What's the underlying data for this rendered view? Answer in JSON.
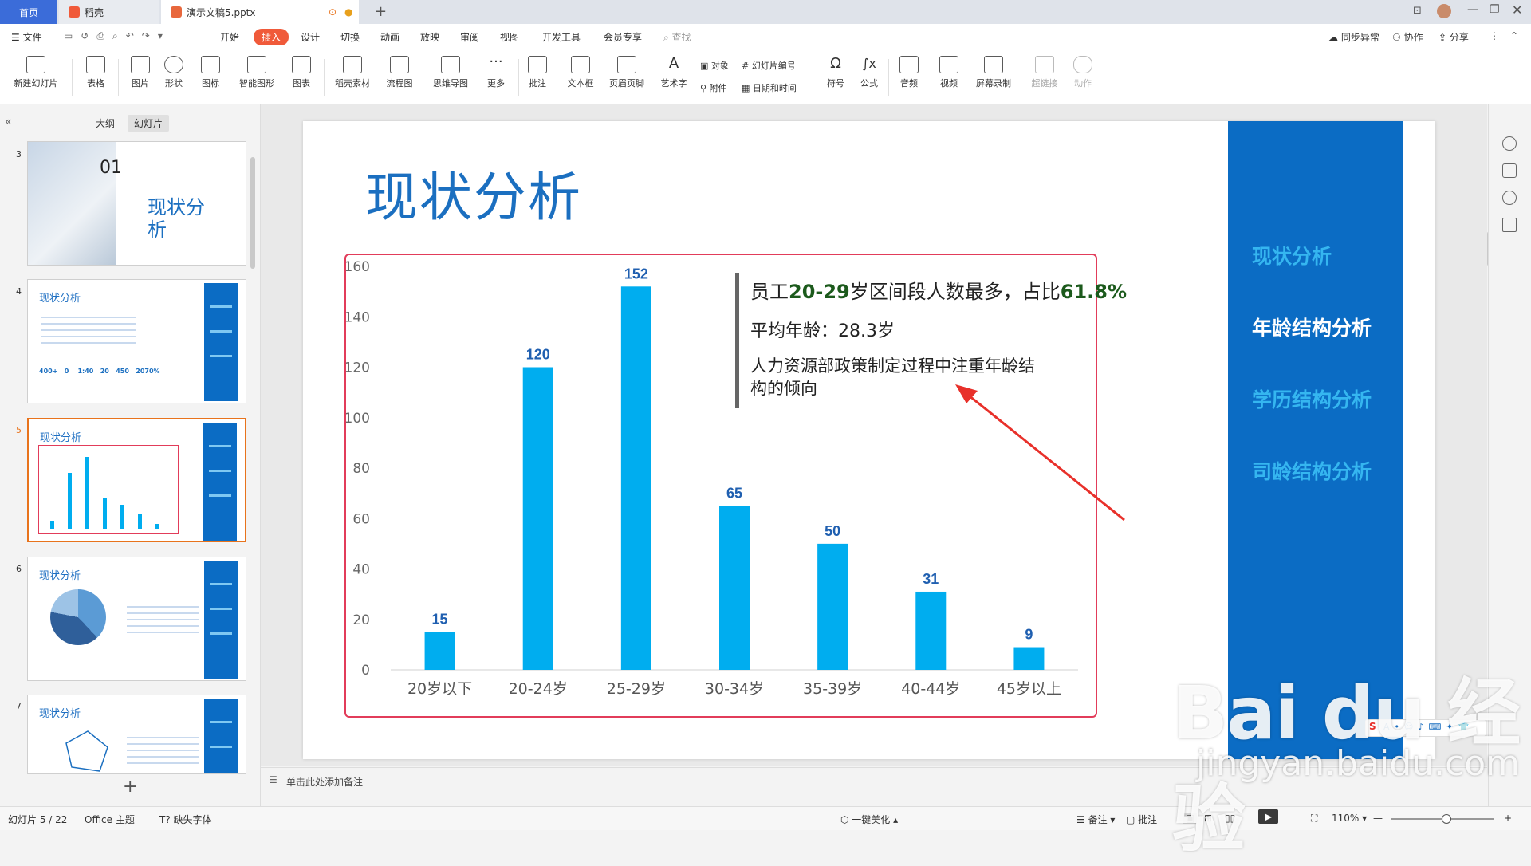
{
  "tabs": {
    "home": "首页",
    "daoke": "稻壳",
    "doc": "演示文稿5.pptx"
  },
  "menu": {
    "file": "文件",
    "items": [
      "开始",
      "插入",
      "设计",
      "切换",
      "动画",
      "放映",
      "审阅",
      "视图",
      "开发工具",
      "会员专享"
    ],
    "search": "查找",
    "sync": "同步异常",
    "collab": "协作",
    "share": "分享"
  },
  "ribbon": {
    "new_slide": "新建幻灯片",
    "table": "表格",
    "picture": "图片",
    "shape": "形状",
    "icon": "图标",
    "smart": "智能图形",
    "chart": "图表",
    "material": "稻壳素材",
    "flow": "流程图",
    "mind": "思维导图",
    "more": "更多",
    "comment": "批注",
    "textbox": "文本框",
    "header": "页眉页脚",
    "art": "艺术字",
    "object": "对象",
    "attach": "附件",
    "slide_num": "幻灯片编号",
    "datetime": "日期和时间",
    "symbol": "符号",
    "formula": "公式",
    "audio": "音频",
    "video": "视频",
    "screen_rec": "屏幕录制",
    "hyperlink": "超链接",
    "action": "动作"
  },
  "panel": {
    "outline": "大纲",
    "slides": "幻灯片"
  },
  "thumbs": [
    {
      "num": "3",
      "title": "现状分析",
      "big": "01"
    },
    {
      "num": "4",
      "title": "现状分析",
      "values": "400+   0    1:40   20   450   2070%"
    },
    {
      "num": "5",
      "title": "现状分析"
    },
    {
      "num": "6",
      "title": "现状分析"
    },
    {
      "num": "7",
      "title": "现状分析"
    }
  ],
  "slide": {
    "title": "现状分析",
    "sidebar": [
      "现状分析",
      "年龄结构分析",
      "学历结构分析",
      "司龄结构分析"
    ],
    "callout": {
      "l1a": "员工",
      "l1b": "20-29",
      "l1c": "岁区间段人数最多，占比",
      "l1d": "61.8%",
      "l2": "平均年龄：28.3岁",
      "l3": "人力资源部政策制定过程中注重年龄结构的倾向"
    }
  },
  "chart_data": {
    "type": "bar",
    "categories": [
      "20岁以下",
      "20-24岁",
      "25-29岁",
      "30-34岁",
      "35-39岁",
      "40-44岁",
      "45岁以上"
    ],
    "values": [
      15,
      120,
      152,
      65,
      50,
      31,
      9
    ],
    "yticks": [
      0,
      20,
      40,
      60,
      80,
      100,
      120,
      140,
      160
    ],
    "ylim": [
      0,
      160
    ],
    "bar_color": "#00adef",
    "label_color": "#1f5fb0",
    "grid": false
  },
  "notes": "单击此处添加备注",
  "status": {
    "slide": "幻灯片 5 / 22",
    "theme": "Office 主题",
    "font": "缺失字体",
    "beautify": "一键美化",
    "remark": "备注",
    "comment": "批注",
    "zoom": "110%"
  },
  "watermark": {
    "logo": "Bai du 经验",
    "sub": "jingyan.baidu.com"
  },
  "colors": {
    "accent": "#0b6cc4",
    "insert_tab": "#f05a3a",
    "chart_border": "#e23c5a"
  }
}
